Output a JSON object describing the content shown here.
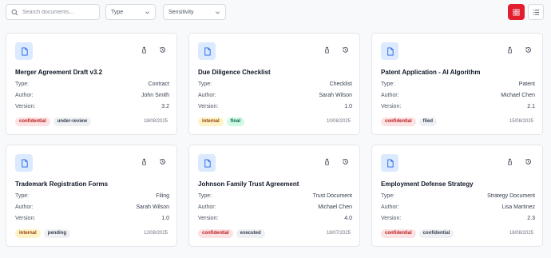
{
  "toolbar": {
    "search_placeholder": "Search documents...",
    "type_filter": "Type",
    "sensitivity_filter": "Sensitivity"
  },
  "labels": {
    "type": "Type:",
    "author": "Author:",
    "version": "Version:"
  },
  "colors": {
    "accent": "#e11d2e",
    "icon_bg": "#dbeafe",
    "icon_fg": "#2563eb"
  },
  "documents": [
    {
      "title": "Merger Agreement Draft v3.2",
      "type": "Contract",
      "author": "John Smith",
      "version": "3.2",
      "date": "18/08/2025",
      "tags": [
        {
          "text": "confidential",
          "style": "red"
        },
        {
          "text": "under-review",
          "style": "gray"
        }
      ]
    },
    {
      "title": "Due Diligence Checklist",
      "type": "Checklist",
      "author": "Sarah Wilson",
      "version": "1.0",
      "date": "10/08/2025",
      "tags": [
        {
          "text": "internal",
          "style": "yellow"
        },
        {
          "text": "final",
          "style": "green"
        }
      ]
    },
    {
      "title": "Patent Application - AI Algorithm",
      "type": "Patent",
      "author": "Michael Chen",
      "version": "2.1",
      "date": "15/08/2025",
      "tags": [
        {
          "text": "confidential",
          "style": "red"
        },
        {
          "text": "filed",
          "style": "gray"
        }
      ]
    },
    {
      "title": "Trademark Registration Forms",
      "type": "Filing",
      "author": "Sarah Wilson",
      "version": "1.0",
      "date": "12/08/2025",
      "tags": [
        {
          "text": "internal",
          "style": "yellow"
        },
        {
          "text": "pending",
          "style": "gray"
        }
      ]
    },
    {
      "title": "Johnson Family Trust Agreement",
      "type": "Trust Document",
      "author": "Michael Chen",
      "version": "4.0",
      "date": "18/07/2025",
      "tags": [
        {
          "text": "confidential",
          "style": "red"
        },
        {
          "text": "executed",
          "style": "gray"
        }
      ]
    },
    {
      "title": "Employment Defense Strategy",
      "type": "Strategy Document",
      "author": "Lisa Martinez",
      "version": "2.3",
      "date": "18/08/2025",
      "tags": [
        {
          "text": "confidential",
          "style": "red"
        },
        {
          "text": "confidential",
          "style": "gray"
        }
      ]
    }
  ]
}
